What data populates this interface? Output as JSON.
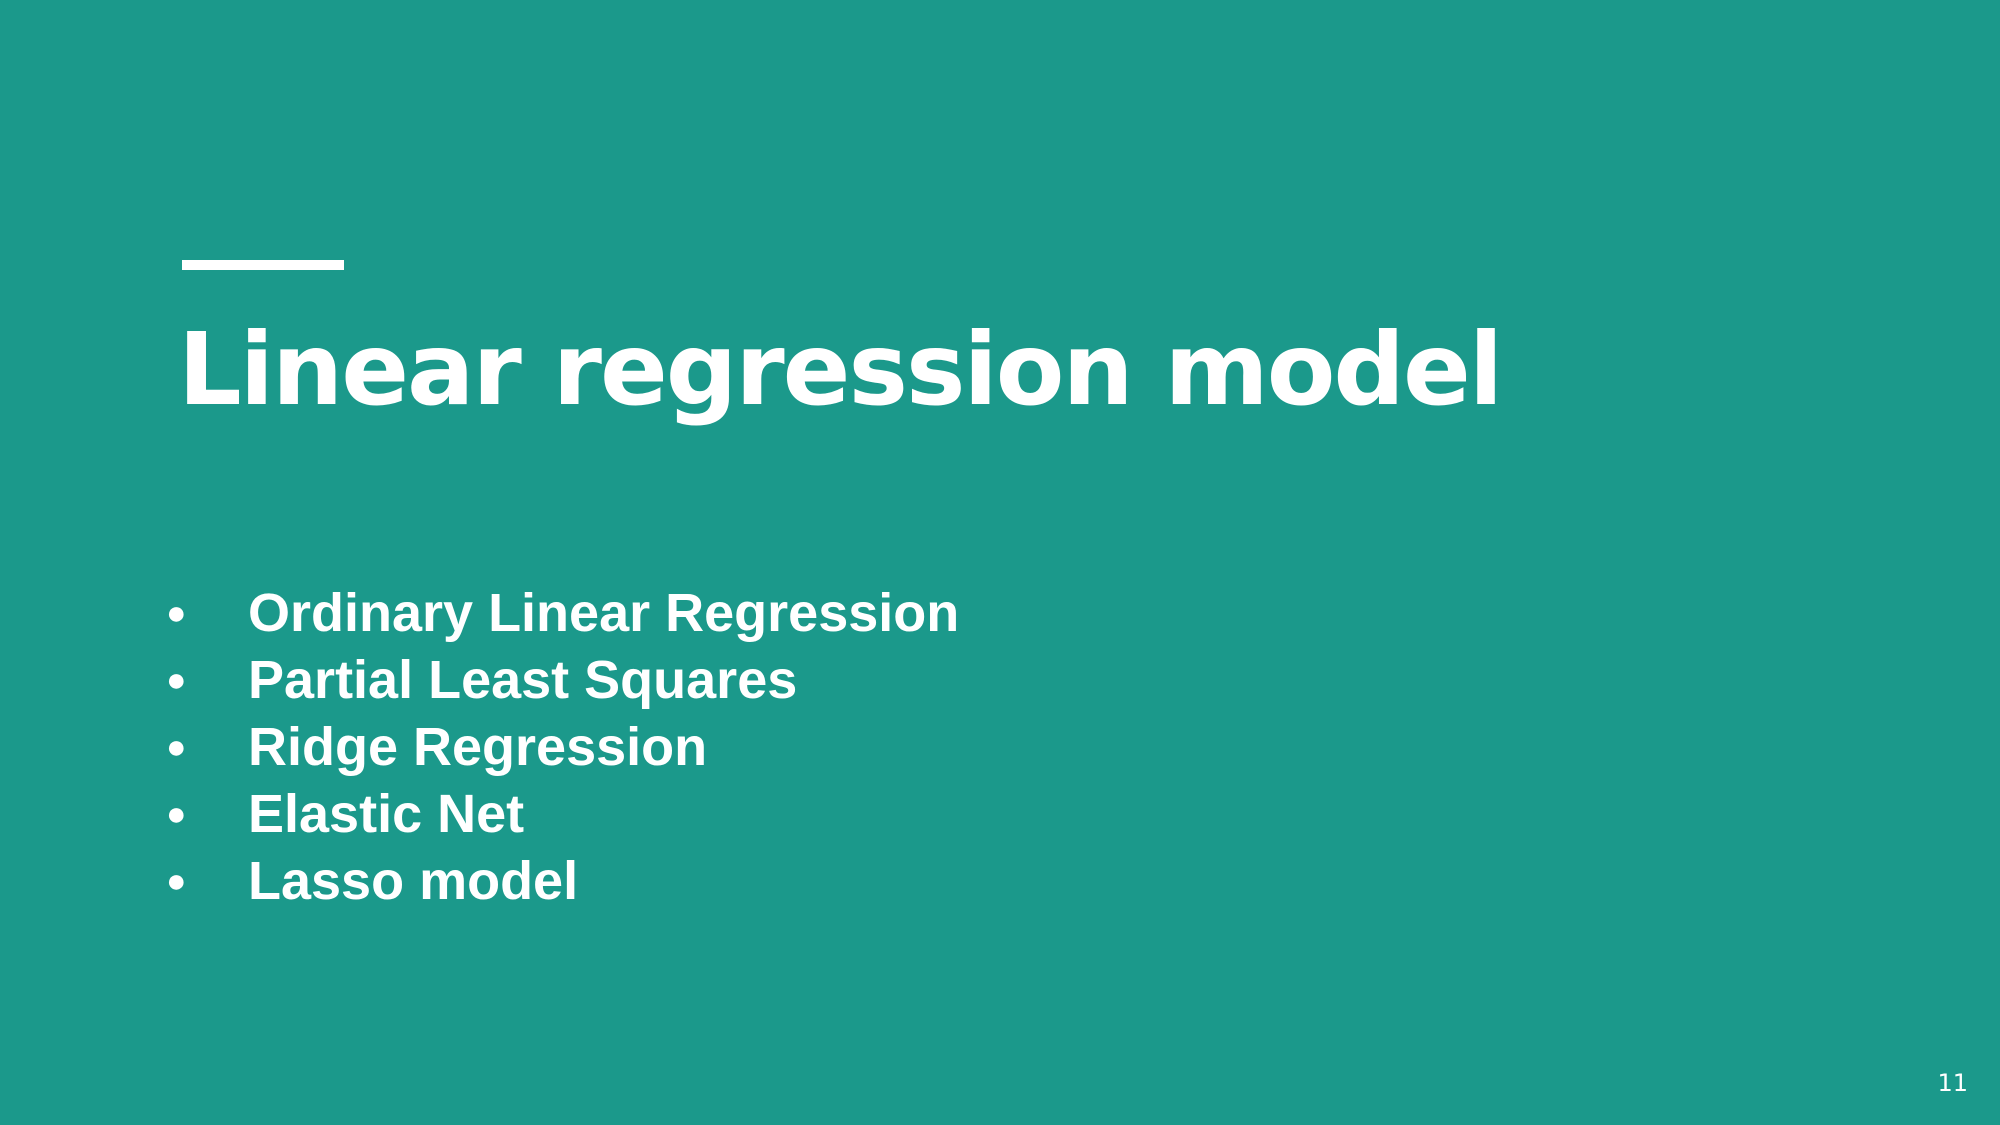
{
  "slide": {
    "title": "Linear regression model",
    "bullets": [
      "Ordinary Linear Regression",
      "Partial Least Squares",
      "Ridge Regression",
      "Elastic Net",
      "Lasso model"
    ],
    "bullet_glyph": "●",
    "page_number": "11"
  },
  "colors": {
    "background": "#1b998b",
    "text": "#ffffff"
  }
}
